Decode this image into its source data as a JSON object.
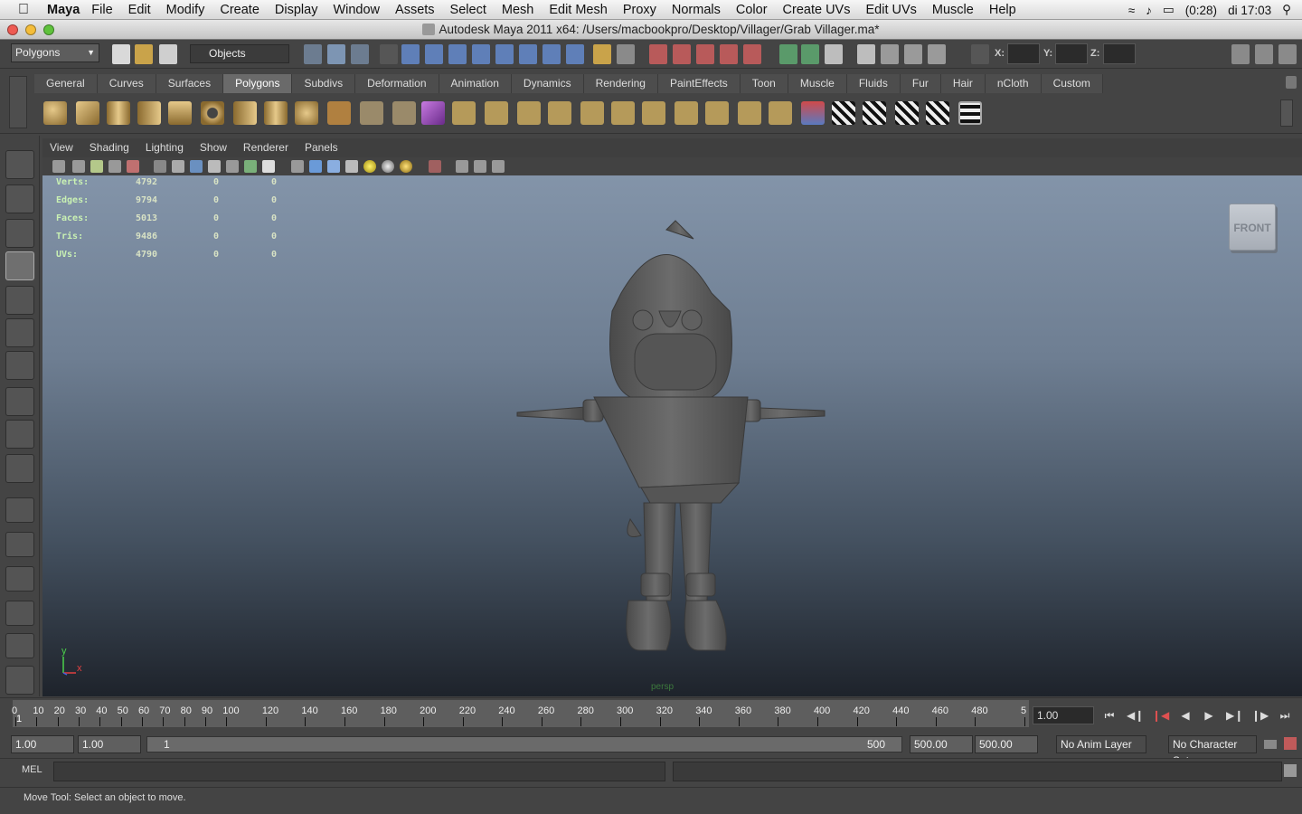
{
  "mac_menubar": {
    "app_name": "Maya",
    "items": [
      "File",
      "Edit",
      "Modify",
      "Create",
      "Display",
      "Window",
      "Assets",
      "Select",
      "Mesh",
      "Edit Mesh",
      "Proxy",
      "Normals",
      "Color",
      "Create UVs",
      "Edit UVs",
      "Muscle",
      "Help"
    ],
    "battery": "(0:28)",
    "clock": "di 17:03",
    "icons": [
      "apple-icon",
      "wifi-icon",
      "volume-icon",
      "battery-icon",
      "spotlight-icon"
    ]
  },
  "window": {
    "title": "Autodesk Maya 2011 x64: /Users/macbookpro/Desktop/Villager/Grab Villager.ma*"
  },
  "status_line": {
    "menu_set": "Polygons",
    "selection_mode": "Objects",
    "coord_labels": [
      "X:",
      "Y:",
      "Z:"
    ]
  },
  "shelf": {
    "tabs": [
      "General",
      "Curves",
      "Surfaces",
      "Polygons",
      "Subdivs",
      "Deformation",
      "Animation",
      "Dynamics",
      "Rendering",
      "PaintEffects",
      "Toon",
      "Muscle",
      "Fluids",
      "Fur",
      "Hair",
      "nCloth",
      "Custom"
    ],
    "active_tab": "Polygons"
  },
  "panel": {
    "menu": [
      "View",
      "Shading",
      "Lighting",
      "Show",
      "Renderer",
      "Panels"
    ],
    "camera_name": "persp",
    "viewcube_label": "FRONT",
    "axis_labels": {
      "y": "y",
      "x": "x"
    }
  },
  "hud": {
    "rows": [
      {
        "label": "Verts:",
        "v1": "4792",
        "v2": "0",
        "v3": "0"
      },
      {
        "label": "Edges:",
        "v1": "9794",
        "v2": "0",
        "v3": "0"
      },
      {
        "label": "Faces:",
        "v1": "5013",
        "v2": "0",
        "v3": "0"
      },
      {
        "label": "Tris:",
        "v1": "9486",
        "v2": "0",
        "v3": "0"
      },
      {
        "label": "UVs:",
        "v1": "4790",
        "v2": "0",
        "v3": "0"
      }
    ]
  },
  "time_slider": {
    "ticks": [
      "0",
      "10",
      "20",
      "30",
      "40",
      "50",
      "60",
      "70",
      "80",
      "90",
      "100",
      "120",
      "140",
      "160",
      "180",
      "200",
      "220",
      "240",
      "260",
      "280",
      "300",
      "320",
      "340",
      "360",
      "380",
      "400",
      "420",
      "440",
      "460",
      "480",
      "5"
    ],
    "current_marker": "1",
    "current_frame": "1.00"
  },
  "range_slider": {
    "start_time": "1.00",
    "playback_start": "1.00",
    "range_min": "1",
    "range_max": "500",
    "playback_end": "500.00",
    "end_time": "500.00",
    "anim_layer": "No Anim Layer",
    "character_set": "No Character Set"
  },
  "command_line": {
    "label": "MEL"
  },
  "help_line": {
    "text": "Move Tool: Select an object to move."
  },
  "colors": {
    "viewport_top": "#8394a9",
    "viewport_bottom": "#1e232b",
    "ui_gray": "#444444",
    "hud_text": "#c9f1b3"
  }
}
